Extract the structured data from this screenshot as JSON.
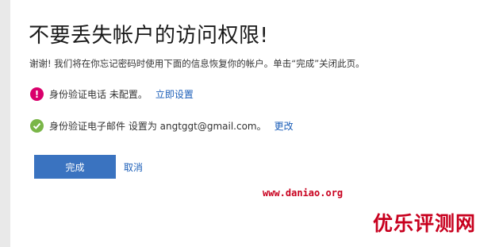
{
  "page": {
    "title": "不要丢失帐户的访问权限!",
    "intro": "谢谢! 我们将在你忘记密码时使用下面的信息恢复你的帐户。单击“完成”关闭此页。"
  },
  "phone": {
    "icon": "warning-icon",
    "text": "身份验证电话 未配置。",
    "link": "立即设置"
  },
  "email": {
    "icon": "check-icon",
    "text": "身份验证电子邮件 设置为 angtggt@gmail.com。",
    "link": "更改"
  },
  "actions": {
    "done_label": "完成",
    "cancel_label": "取消"
  },
  "watermark": {
    "url": "www.daniao.org",
    "brand": "优乐评测网"
  },
  "colors": {
    "accent": "#3a73c0",
    "link": "#1b5eb8",
    "warning": "#d9006c",
    "success": "#7ab648",
    "watermark": "#c8001e"
  }
}
